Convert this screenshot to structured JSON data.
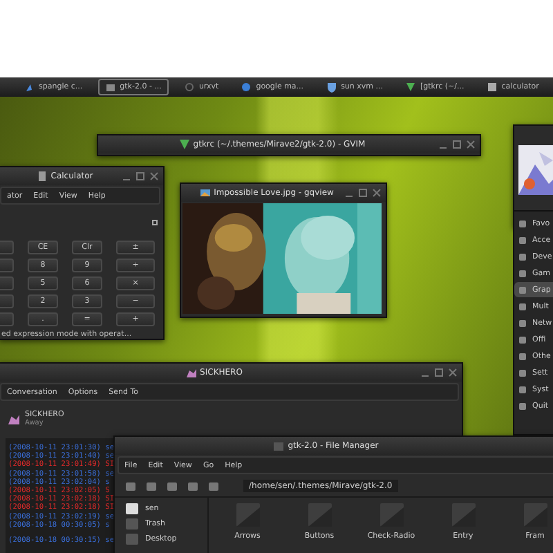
{
  "taskbar": {
    "tasks": [
      {
        "label": "spangle c...",
        "selected": false
      },
      {
        "label": "gtk-2.0 - ...",
        "selected": true
      },
      {
        "label": "urxvt",
        "selected": false
      },
      {
        "label": "google ma...",
        "selected": false
      },
      {
        "label": "sun xvm ...",
        "selected": false
      },
      {
        "label": "[gtkrc (~/...",
        "selected": false
      },
      {
        "label": "calculator",
        "selected": false
      }
    ]
  },
  "gvim": {
    "title": "gtkrc (~/.themes/Mirave2/gtk-2.0) - GVIM"
  },
  "calculator": {
    "title": "Calculator",
    "menu": [
      "ator",
      "Edit",
      "View",
      "Help"
    ],
    "keys": [
      [
        "CE",
        "Clr",
        "±"
      ],
      [
        "8",
        "9",
        "÷"
      ],
      [
        "5",
        "6",
        "×"
      ],
      [
        "2",
        "3",
        "−"
      ],
      [
        ".",
        "=",
        "+"
      ]
    ],
    "status": "ed expression mode with operat..."
  },
  "viewer": {
    "title": "Impossible Love.jpg - gqview"
  },
  "app_menu": {
    "items": [
      {
        "label": "Favo",
        "selected": false
      },
      {
        "label": "Acce",
        "selected": false
      },
      {
        "label": "Deve",
        "selected": false
      },
      {
        "label": "Gam",
        "selected": false
      },
      {
        "label": "Grap",
        "selected": true
      },
      {
        "label": "Mult",
        "selected": false
      },
      {
        "label": "Netw",
        "selected": false
      },
      {
        "label": "Offi",
        "selected": false
      },
      {
        "label": "Othe",
        "selected": false
      },
      {
        "label": "Sett",
        "selected": false
      },
      {
        "label": "Syst",
        "selected": false
      },
      {
        "label": "Quit",
        "selected": false
      }
    ]
  },
  "chat": {
    "title": "SICKHERO",
    "menu": [
      "Conversation",
      "Options",
      "Send To"
    ],
    "buddy": "SICKHERO",
    "status": "Away",
    "log": [
      {
        "text": "(2008-10-11 23:01:30) se",
        "color": "#3a6ed8"
      },
      {
        "text": "(2008-10-11 23:01:40) se",
        "color": "#3a6ed8"
      },
      {
        "text": "(2008-10-11 23:01:49) SI",
        "color": "#e02a2a"
      },
      {
        "text": "(2008-10-11 23:01:58) se",
        "color": "#3a6ed8"
      },
      {
        "text": "(2008-10-11 23:02:04) s",
        "color": "#3a6ed8"
      },
      {
        "text": "(2008-10-11 23:02:05) S",
        "color": "#e02a2a"
      },
      {
        "text": "(2008-10-11 23:02:18) SI",
        "color": "#e02a2a"
      },
      {
        "text": "(2008-10-11 23:02:18) SI",
        "color": "#e02a2a"
      },
      {
        "text": "(2008-10-11 23:02:19) se",
        "color": "#3a6ed8"
      },
      {
        "text": "(2008-10-18 00:30:05) s",
        "color": "#3a6ed8"
      },
      {
        "text": "(2008-10-18 00:30:15) se",
        "color": "#3a6ed8"
      }
    ]
  },
  "file_manager": {
    "title": "gtk-2.0 - File Manager",
    "menu": [
      "File",
      "Edit",
      "View",
      "Go",
      "Help"
    ],
    "path": "/home/sen/.themes/Mirave/gtk-2.0",
    "places": [
      "sen",
      "Trash",
      "Desktop"
    ],
    "folders": [
      "Arrows",
      "Buttons",
      "Check-Radio",
      "Entry",
      "Fram"
    ]
  }
}
